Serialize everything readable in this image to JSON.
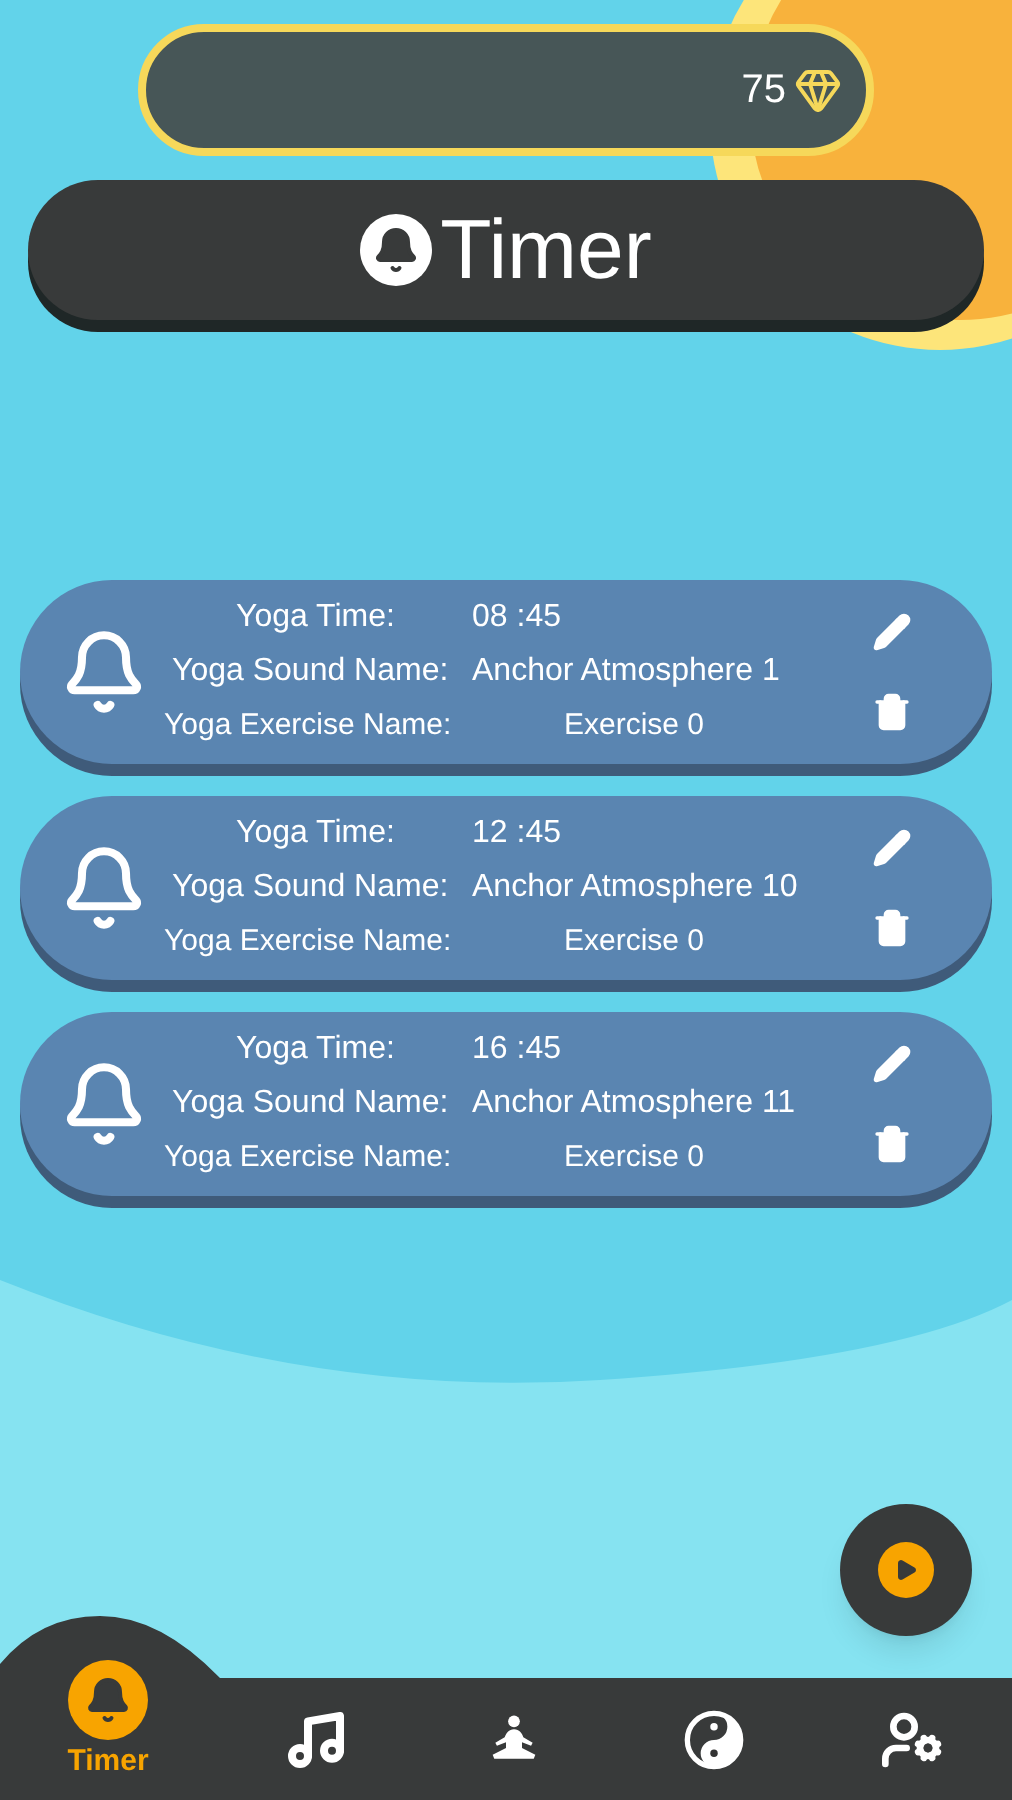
{
  "coins": {
    "value": "75"
  },
  "header": {
    "title": "Timer"
  },
  "timers": [
    {
      "time_label": "Yoga Time:",
      "time": "08 :45",
      "sound_label": "Yoga Sound Name:",
      "sound": "Anchor Atmosphere 1",
      "exercise_label": "Yoga Exercise Name:",
      "exercise": "Exercise 0"
    },
    {
      "time_label": "Yoga Time:",
      "time": "12 :45",
      "sound_label": "Yoga Sound Name:",
      "sound": "Anchor Atmosphere 10",
      "exercise_label": "Yoga Exercise Name:",
      "exercise": "Exercise 0"
    },
    {
      "time_label": "Yoga Time:",
      "time": "16 :45",
      "sound_label": "Yoga Sound Name:",
      "sound": "Anchor Atmosphere 11",
      "exercise_label": "Yoga Exercise Name:",
      "exercise": "Exercise 0"
    }
  ],
  "nav": [
    {
      "kind": "bell",
      "label": "Timer",
      "selected": true
    },
    {
      "kind": "music",
      "selected": false
    },
    {
      "kind": "meditation",
      "selected": false
    },
    {
      "kind": "yinyang",
      "selected": false
    },
    {
      "kind": "user-settings",
      "selected": false
    }
  ]
}
